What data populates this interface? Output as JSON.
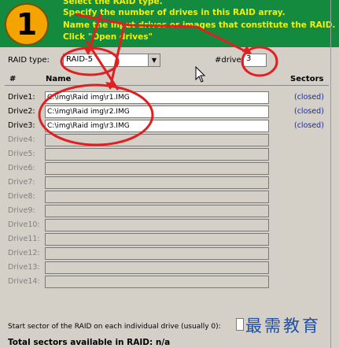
{
  "step": {
    "number": "1"
  },
  "instructions": [
    "Select the RAID type.",
    "Specify the number of drives in this RAID array.",
    "Name the input drives or images that constitute the RAID.",
    "Click \"Open drives\""
  ],
  "controls": {
    "raid_type_label": "RAID type:",
    "raid_type_value": "RAID-5",
    "drives_count_label": "#drives:",
    "drives_count_value": "3"
  },
  "table": {
    "col_num": "#",
    "col_name": "Name",
    "col_sectors": "Sectors",
    "rows": [
      {
        "label": "Drive1:",
        "path": "C:\\img\\Raid img\\r1.IMG",
        "sectors": "(closed)"
      },
      {
        "label": "Drive2:",
        "path": "C:\\img\\Raid img\\r2.IMG",
        "sectors": "(closed)"
      },
      {
        "label": "Drive3:",
        "path": "C:\\img\\Raid img\\r3.IMG",
        "sectors": "(closed)"
      },
      {
        "label": "Drive4:",
        "path": "",
        "sectors": ""
      },
      {
        "label": "Drive5:",
        "path": "",
        "sectors": ""
      },
      {
        "label": "Drive6:",
        "path": "",
        "sectors": ""
      },
      {
        "label": "Drive7:",
        "path": "",
        "sectors": ""
      },
      {
        "label": "Drive8:",
        "path": "",
        "sectors": ""
      },
      {
        "label": "Drive9:",
        "path": "",
        "sectors": ""
      },
      {
        "label": "Drive10:",
        "path": "",
        "sectors": ""
      },
      {
        "label": "Drive11:",
        "path": "",
        "sectors": ""
      },
      {
        "label": "Drive12:",
        "path": "",
        "sectors": ""
      },
      {
        "label": "Drive13:",
        "path": "",
        "sectors": ""
      },
      {
        "label": "Drive14:",
        "path": "",
        "sectors": ""
      }
    ]
  },
  "footer": {
    "start_sector_label": "Start sector of the RAID on each individual drive (usually 0):",
    "total_label": "Total sectors available in RAID:",
    "total_value": "n/a"
  },
  "watermark": "最需教育",
  "colors": {
    "banner": "#138a3e",
    "instruction_text": "#f5f000",
    "step_circle": "#f4a400",
    "annotation": "#e02020",
    "sector_text": "#1a2a9a"
  }
}
